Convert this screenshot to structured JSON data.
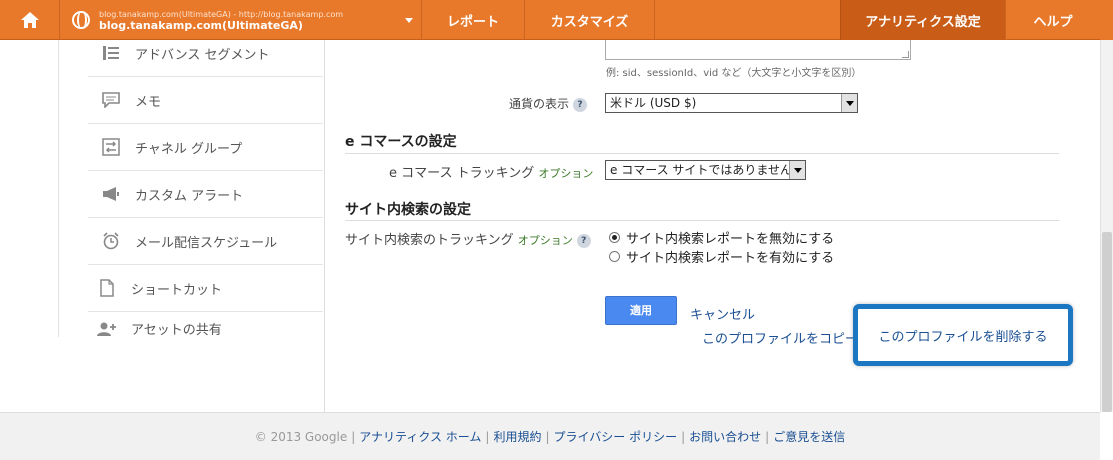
{
  "topbar": {
    "account_url_line": "blog.tanakamp.com(UltimateGA) - http://blog.tanakamp.com",
    "account_name": "blog.tanakamp.com(UltimateGA)",
    "nav": [
      "レポート",
      "カスタマイズ",
      "アナリティクス設定",
      "ヘルプ"
    ]
  },
  "sidebar": {
    "items": [
      {
        "label": "アドバンス セグメント",
        "icon": "segment-icon"
      },
      {
        "label": "メモ",
        "icon": "memo-icon"
      },
      {
        "label": "チャネル グループ",
        "icon": "channel-group-icon"
      },
      {
        "label": "カスタム アラート",
        "icon": "megaphone-icon"
      },
      {
        "label": "メール配信スケジュール",
        "icon": "alarm-clock-icon"
      },
      {
        "label": "ショートカット",
        "icon": "document-icon"
      },
      {
        "label": "アセットの共有",
        "icon": "add-user-icon"
      }
    ]
  },
  "form": {
    "query_hint": "例: sid、sessionId、vid など（大文字と小文字を区別）",
    "currency_label": "通貨の表示",
    "currency_value": "米ドル (USD $)",
    "ecommerce_heading": "e コマースの設定",
    "ecommerce_label": "e コマース トラッキング",
    "option_text": "オプション",
    "ecommerce_value": "e コマース サイトではありません",
    "sitesearch_heading": "サイト内検索の設定",
    "sitesearch_label": "サイト内検索のトラッキング",
    "sitesearch_options": [
      "サイト内検索レポートを無効にする",
      "サイト内検索レポートを有効にする"
    ],
    "sitesearch_selected": 0,
    "help": "?",
    "apply_label": "適用",
    "cancel_label": "キャンセル",
    "copy_profile_label": "このプロファイルをコピー",
    "delete_profile_label": "このプロファイルを削除する"
  },
  "footer": {
    "copyright": "© 2013 Google",
    "separator": "|",
    "links": [
      "アナリティクス ホーム",
      "利用規約",
      "プライバシー ポリシー",
      "お問い合わせ",
      "ご意見を送信"
    ]
  },
  "colors": {
    "topbar": "#e8782a",
    "topbar_active": "#c95d17",
    "link": "#1a4f93",
    "apply_button": "#4a8af0",
    "highlight_border": "#1c77c3"
  }
}
